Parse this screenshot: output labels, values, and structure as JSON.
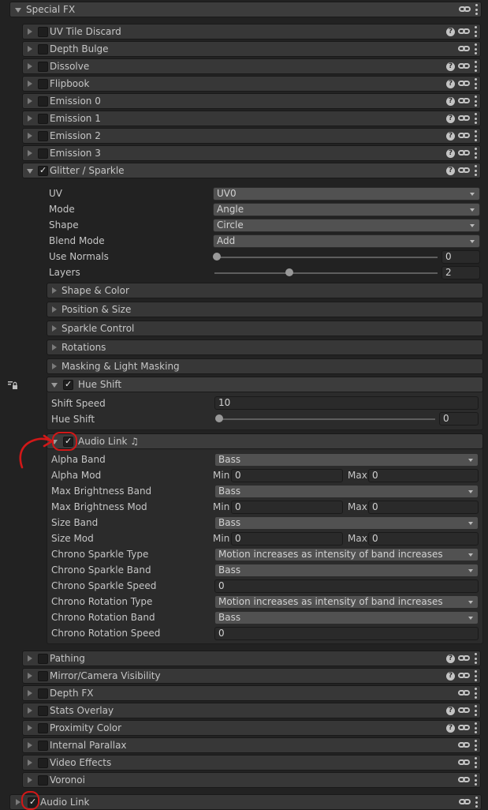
{
  "special_fx": {
    "label": "Special FX"
  },
  "modules": [
    {
      "label": "UV Tile Discard"
    },
    {
      "label": "Depth Bulge"
    },
    {
      "label": "Dissolve"
    },
    {
      "label": "Flipbook"
    },
    {
      "label": "Emission 0"
    },
    {
      "label": "Emission 1"
    },
    {
      "label": "Emission 2"
    },
    {
      "label": "Emission 3"
    },
    {
      "label": "Glitter / Sparkle"
    }
  ],
  "glitter": {
    "uv_label": "UV",
    "uv_value": "UV0",
    "mode_label": "Mode",
    "mode_value": "Angle",
    "shape_label": "Shape",
    "shape_value": "Circle",
    "blend_label": "Blend Mode",
    "blend_value": "Add",
    "normals_label": "Use Normals",
    "normals_value": "0",
    "layers_label": "Layers",
    "layers_value": "2",
    "subsections": [
      "Shape & Color",
      "Position & Size",
      "Sparkle Control",
      "Rotations",
      "Masking & Light Masking"
    ]
  },
  "hue_shift": {
    "label": "Hue Shift",
    "speed_label": "Shift Speed",
    "speed_value": "10",
    "hue_label": "Hue Shift",
    "hue_value": "0"
  },
  "audio_link_sub": {
    "label": "Audio Link ♫",
    "min_label": "Min",
    "max_label": "Max",
    "alpha_band_label": "Alpha Band",
    "alpha_band_value": "Bass",
    "alpha_mod_label": "Alpha Mod",
    "alpha_mod_min": "0",
    "alpha_mod_max": "0",
    "max_bright_band_label": "Max Brightness Band",
    "max_bright_band_value": "Bass",
    "max_bright_mod_label": "Max Brightness Mod",
    "max_bright_mod_min": "0",
    "max_bright_mod_max": "0",
    "size_band_label": "Size Band",
    "size_band_value": "Bass",
    "size_mod_label": "Size Mod",
    "size_mod_min": "0",
    "size_mod_max": "0",
    "chrono_sparkle_type_label": "Chrono Sparkle Type",
    "chrono_sparkle_type_value": "Motion increases as intensity of band increases",
    "chrono_sparkle_band_label": "Chrono Sparkle Band",
    "chrono_sparkle_band_value": "Bass",
    "chrono_sparkle_speed_label": "Chrono Sparkle Speed",
    "chrono_sparkle_speed_value": "0",
    "chrono_rotation_type_label": "Chrono Rotation Type",
    "chrono_rotation_type_value": "Motion increases as intensity of band increases",
    "chrono_rotation_band_label": "Chrono Rotation Band",
    "chrono_rotation_band_value": "Bass",
    "chrono_rotation_speed_label": "Chrono Rotation Speed",
    "chrono_rotation_speed_value": "0"
  },
  "modules_after": [
    {
      "label": "Pathing"
    },
    {
      "label": "Mirror/Camera Visibility"
    },
    {
      "label": "Depth FX"
    },
    {
      "label": "Stats Overlay"
    },
    {
      "label": "Proximity Color"
    },
    {
      "label": "Internal Parallax"
    },
    {
      "label": "Video Effects"
    },
    {
      "label": "Voronoi"
    }
  ],
  "audio_link_main": {
    "label": "Audio Link"
  },
  "colors": {
    "annotation": "#d11818",
    "panel": "#373737",
    "background": "#222222"
  }
}
